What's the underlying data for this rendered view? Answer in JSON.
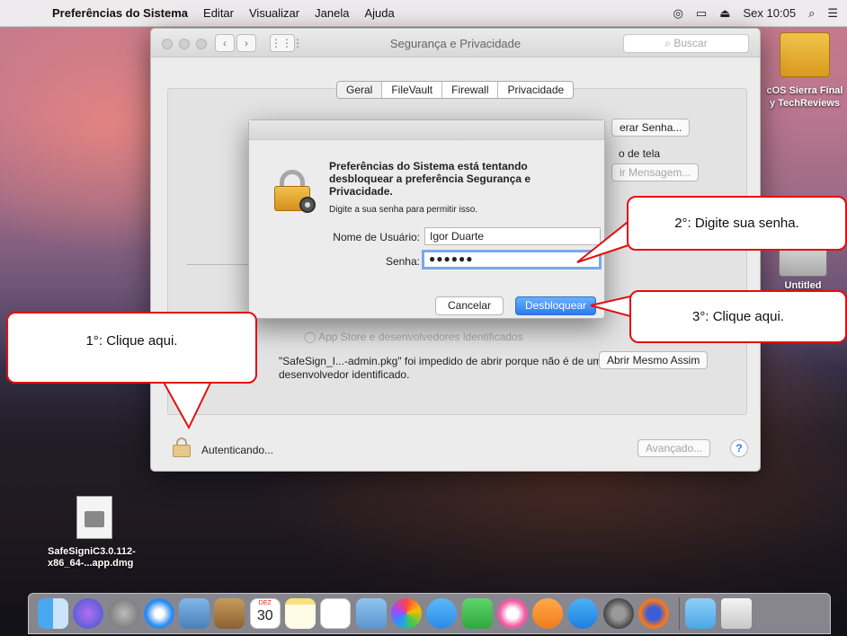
{
  "menubar": {
    "app_name": "Preferências do Sistema",
    "items": [
      "Editar",
      "Visualizar",
      "Janela",
      "Ajuda"
    ],
    "clock": "Sex 10:05"
  },
  "desktop": {
    "drive_label": "cOS Sierra Final\ny TechReviews",
    "untitled_label": "Untitled",
    "dmg_label": "SafeSigniC3.0.112-\nx86_64-...app.dmg"
  },
  "window": {
    "title": "Segurança e Privacidade",
    "search_placeholder": "Buscar",
    "tabs": [
      "Geral",
      "FileVault",
      "Firewall",
      "Privacidade"
    ],
    "change_password": "erar Senha...",
    "screen_option": "o de tela",
    "message_button": "ir Mensagem...",
    "app_store_option": "App Store e desenvolvedores identificados",
    "blocked_message": "\"SafeSign_I...-admin.pkg\" foi impedido de abrir porque não é de um desenvolvedor identificado.",
    "open_anyway": "Abrir Mesmo Assim",
    "authenticating": "Autenticando...",
    "advanced": "Avançado...",
    "help": "?"
  },
  "auth": {
    "heading": "Preferências do Sistema está tentando desbloquear a preferência Segurança e Privacidade.",
    "subtext": "Digite a sua senha para permitir isso.",
    "username_label": "Nome de Usuário:",
    "username_value": "Igor Duarte",
    "password_label": "Senha:",
    "password_value": "●●●●●●",
    "cancel": "Cancelar",
    "unlock": "Desbloquear"
  },
  "callouts": {
    "step1": "1°: Clique aqui.",
    "step2": "2°: Digite sua senha.",
    "step3": "3°: Clique aqui."
  },
  "dock": {
    "calendar_day": "30",
    "calendar_month": "DEZ"
  }
}
